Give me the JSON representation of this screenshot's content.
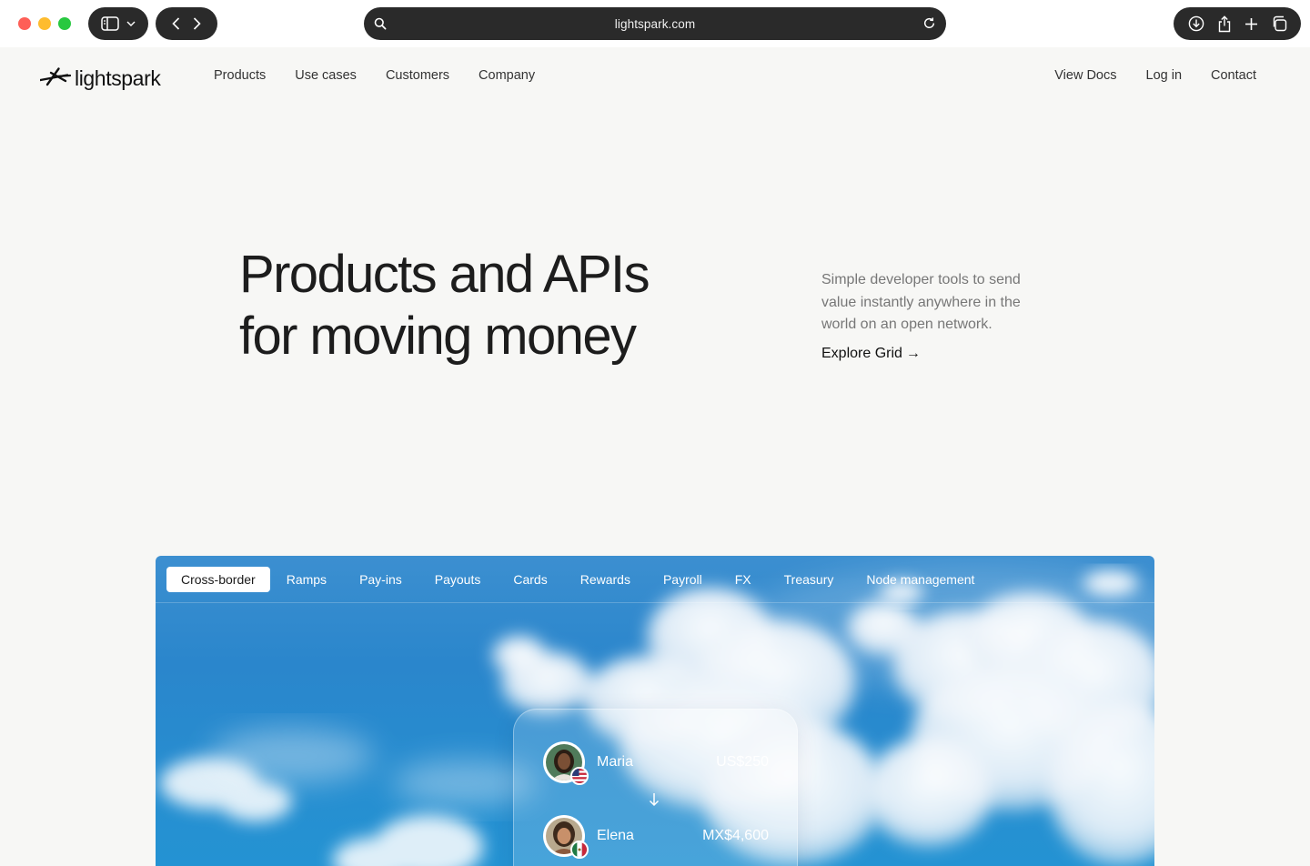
{
  "browser": {
    "url": "lightspark.com",
    "icons": {
      "sidebar": "sidebar-icon",
      "chevron": "chevron-down-icon",
      "back": "back-icon",
      "forward": "forward-icon",
      "search": "search-icon",
      "reload": "reload-icon",
      "download": "download-icon",
      "share": "share-icon",
      "new_tab": "plus-icon",
      "tabs": "tabs-overview-icon"
    }
  },
  "site": {
    "logo": "lightspark",
    "nav_left": [
      "Products",
      "Use cases",
      "Customers",
      "Company"
    ],
    "nav_right": [
      "View Docs",
      "Log in",
      "Contact"
    ]
  },
  "hero": {
    "title_line1": "Products and APIs",
    "title_line2": "for moving money",
    "subtitle": "Simple developer tools to send value instantly anywhere in the world on an open network.",
    "cta": "Explore Grid",
    "cta_arrow": "→"
  },
  "showcase": {
    "tabs": [
      "Cross-border",
      "Ramps",
      "Pay-ins",
      "Payouts",
      "Cards",
      "Rewards",
      "Payroll",
      "FX",
      "Treasury",
      "Node management"
    ],
    "active_tab": "Cross-border",
    "transfer": {
      "sender": {
        "name": "Maria",
        "amount": "US$250",
        "flag": "us-flag"
      },
      "receiver": {
        "name": "Elena",
        "amount": "MX$4,600",
        "flag": "mx-flag"
      }
    }
  },
  "colors": {
    "page_bg": "#f7f7f5",
    "sky_top": "#3c8fd0",
    "sky_bottom": "#2493d3",
    "text_dark": "#1d1d1d",
    "text_muted": "#777777"
  }
}
